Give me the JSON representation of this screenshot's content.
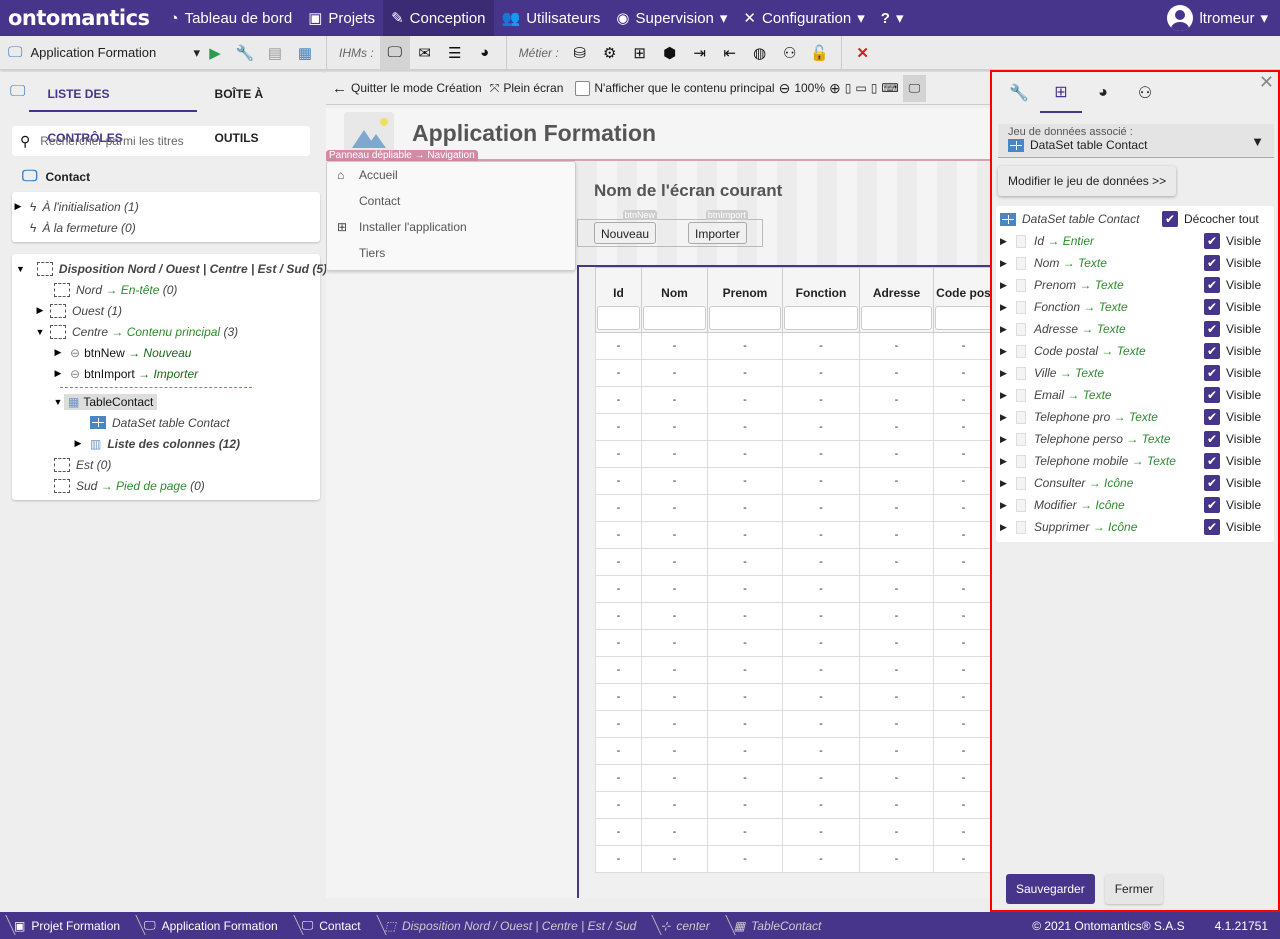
{
  "brand": "ontomantics",
  "nav": {
    "items": [
      {
        "label": "Tableau de bord",
        "icon": "dashboard-icon"
      },
      {
        "label": "Projets",
        "icon": "briefcase-icon"
      },
      {
        "label": "Conception",
        "icon": "tools-icon",
        "active": true
      },
      {
        "label": "Utilisateurs",
        "icon": "users-icon"
      },
      {
        "label": "Supervision",
        "icon": "eye-icon",
        "dropdown": true
      },
      {
        "label": "Configuration",
        "icon": "wrench-screwdriver-icon",
        "dropdown": true
      },
      {
        "label": "?",
        "dropdown": true
      }
    ],
    "user": "ltromeur"
  },
  "toolbar": {
    "app": "Application Formation",
    "ihms_label": "IHMs :",
    "metier_label": "Métier :"
  },
  "left": {
    "tabs": [
      "LISTE DES CONTRÔLES",
      "BOÎTE À OUTILS"
    ],
    "search_placeholder": "Rechercher parmi les titres",
    "screen": "Contact",
    "events": [
      {
        "label": "À l'initialisation (1)"
      },
      {
        "label": "À la fermeture (0)"
      }
    ],
    "tree": {
      "layout": "Disposition Nord / Ouest | Centre | Est / Sud (5)",
      "nord": "Nord",
      "nord_target": "→ En-tête",
      "nord_count": "(0)",
      "ouest": "Ouest (1)",
      "centre": "Centre",
      "centre_target": "→ Contenu principal",
      "centre_count": "(3)",
      "btn_new": "btnNew",
      "btn_new_target": "→ Nouveau",
      "btn_import": "btnImport",
      "btn_import_target": "→ Importer",
      "table": "TableContact",
      "dataset": "DataSet table Contact",
      "columns": "Liste des colonnes (12)",
      "est": "Est (0)",
      "sud": "Sud",
      "sud_target": "→ Pied de page",
      "sud_count": "(0)"
    }
  },
  "center": {
    "toolbar": {
      "quit": "Quitter le mode Création",
      "fullscreen": "Plein écran",
      "main_only": "N'afficher que le contenu principal",
      "zoom": "100%"
    },
    "preview": {
      "app_title": "Application Formation",
      "nav_tag": "Panneau dépliable → Navigation",
      "nav_links": [
        "Accueil",
        "Contact",
        "Installer l'application",
        "Tiers"
      ],
      "screen_name": "Nom de l'écran courant",
      "btn_new": "Nouveau",
      "btn_new_tag": "btnNew",
      "btn_import": "Importer",
      "btn_import_tag": "btnImport",
      "table_headers": [
        "Id",
        "Nom",
        "Prenom",
        "Fonction",
        "Adresse",
        "Code pos"
      ],
      "empty_cell": "-"
    }
  },
  "right": {
    "dataset_label": "Jeu de données associé :",
    "dataset_value": "DataSet table Contact",
    "modify_button": "Modifier le jeu de données >>",
    "list_title": "DataSet table Contact",
    "uncheck_all": "Décocher tout",
    "visible_label": "Visible",
    "columns": [
      {
        "name": "Id",
        "type": "→ Entier"
      },
      {
        "name": "Nom",
        "type": "→ Texte"
      },
      {
        "name": "Prenom",
        "type": "→ Texte"
      },
      {
        "name": "Fonction",
        "type": "→ Texte"
      },
      {
        "name": "Adresse",
        "type": "→ Texte"
      },
      {
        "name": "Code postal",
        "type": "→ Texte"
      },
      {
        "name": "Ville",
        "type": "→ Texte"
      },
      {
        "name": "Email",
        "type": "→ Texte"
      },
      {
        "name": "Telephone pro",
        "type": "→ Texte"
      },
      {
        "name": "Telephone perso",
        "type": "→ Texte"
      },
      {
        "name": "Telephone mobile",
        "type": "→ Texte"
      },
      {
        "name": "Consulter",
        "type": "→ Icône"
      },
      {
        "name": "Modifier",
        "type": "→ Icône"
      },
      {
        "name": "Supprimer",
        "type": "→ Icône"
      }
    ],
    "save": "Sauvegarder",
    "close": "Fermer"
  },
  "footer": {
    "crumbs": [
      "Projet Formation",
      "Application Formation",
      "Contact",
      "Disposition Nord / Ouest | Centre | Est / Sud",
      "center",
      "TableContact"
    ],
    "copyright": "© 2021 Ontomantics® S.A.S",
    "version": "4.1.21751"
  },
  "colors": {
    "brand": "#47348b",
    "highlight_border": "#ff0000",
    "type_green": "#2e8b2e"
  }
}
